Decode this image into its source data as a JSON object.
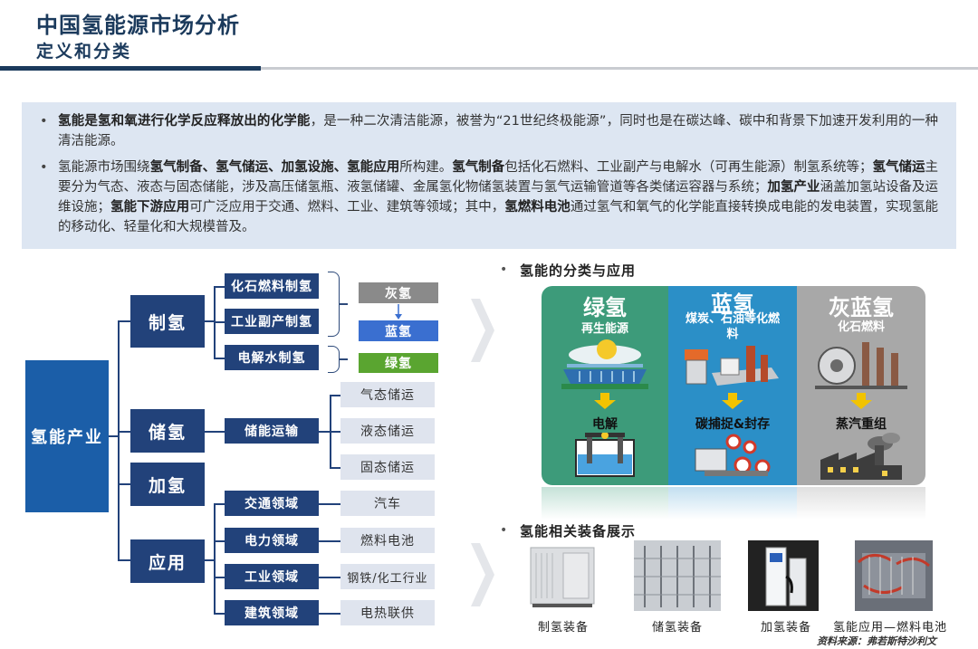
{
  "header": {
    "title": "中国氢能源市场分析",
    "subtitle": "定义和分类"
  },
  "summary": {
    "p1": {
      "s1": "氢能是氢和氧进行化学反应释放出的化学能",
      "s2": "，是一种二次清洁能源，被誉为“21世纪终极能源”，同时也是在碳达峰、碳中和背景下加速开发利用的一种清洁能源。"
    },
    "p2": {
      "s1": "氢能源市场围绕",
      "s2": "氢气制备、氢气储运、加氢设施、氢能应用",
      "s3": "所构建。",
      "s4": "氢气制备",
      "s5": "包括化石燃料、工业副产与电解水（可再生能源）制氢系统等；",
      "s6": "氢气储运",
      "s7": "主要分为气态、液态与固态储能，涉及高压储氢瓶、液氢储罐、金属氢化物储氢装置与氢气运输管道等各类储运容器与系统；",
      "s8": "加氢产业",
      "s9": "涵盖加氢站设备及运维设施；",
      "s10": "氢能下游应用",
      "s11": "可广泛应用于交通、燃料、工业、建筑等领域；其中，",
      "s12": "氢燃料电池",
      "s13": "通过氢气和氧气的化学能直接转换成电能的发电装置，实现氢能的移动化、轻量化和大规模普及。"
    }
  },
  "tree": {
    "root": "氢能产业",
    "l1": [
      "制氢",
      "储氢",
      "加氢",
      "应用"
    ],
    "produce": [
      "化石燃料制氢",
      "工业副产制氢",
      "电解水制氢"
    ],
    "colors": [
      "灰氢",
      "蓝氢",
      "绿氢"
    ],
    "storage": "储能运输",
    "storage_types": [
      "气态储运",
      "液态储运",
      "固态储运"
    ],
    "apps": [
      "交通领域",
      "电力领域",
      "工业领域",
      "建筑领域"
    ],
    "app_uses": [
      "汽车",
      "燃料电池",
      "钢铁/化工行业",
      "电热联供"
    ]
  },
  "section_classify": "氢能的分类与应用",
  "classify": [
    {
      "title": "绿氢",
      "sub": "再生能源",
      "step": "电解",
      "color": "#3d9b7a"
    },
    {
      "title": "蓝氢",
      "sub": "煤炭、石油等化燃料",
      "step": "碳捕捉&封存",
      "color": "#2b8fc7"
    },
    {
      "title": "灰蓝氢",
      "sub": "化石燃料",
      "step": "蒸汽重组",
      "color": "#a8a8a8"
    }
  ],
  "section_equip": "氢能相关装备展示",
  "equipment": [
    "制氢装备",
    "储氢装备",
    "加氢装备",
    "氢能应用—燃料电池"
  ],
  "source": "资料来源：弗若斯特沙利文",
  "bullet": "•",
  "chart_colors": {
    "navy": "#22427a",
    "gray": "#8a8a8a",
    "blue": "#3a6fd0",
    "green": "#5aa530"
  }
}
